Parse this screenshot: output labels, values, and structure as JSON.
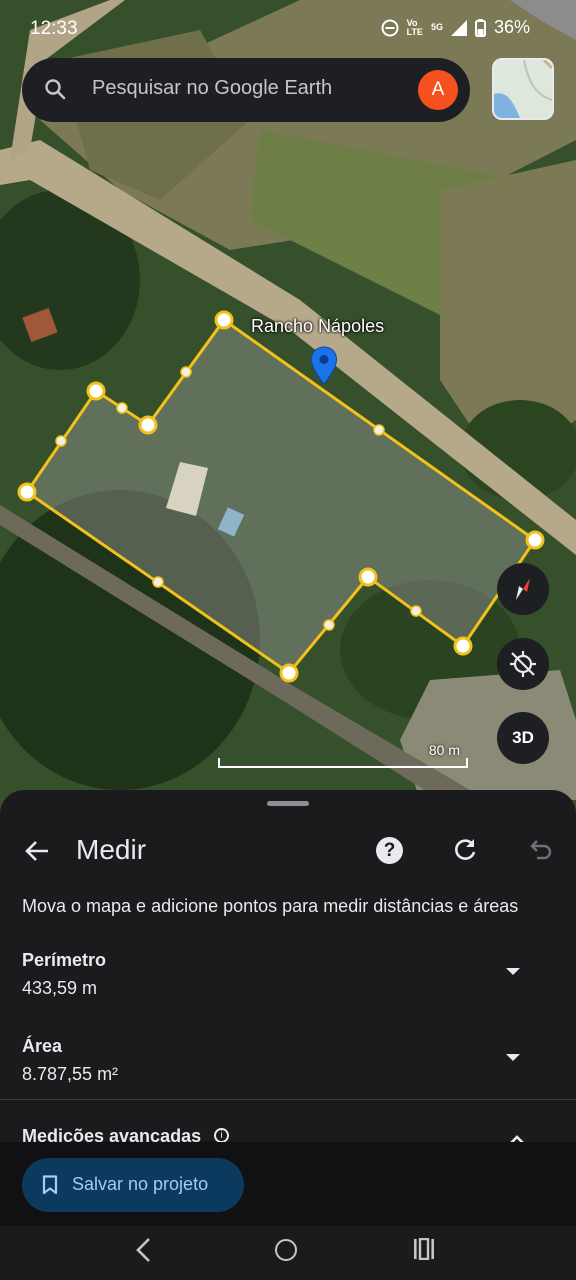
{
  "status": {
    "time": "12:33",
    "network_top": "Vo",
    "network_mid": "LTE",
    "network_type": "5G",
    "battery": "36%"
  },
  "search": {
    "placeholder": "Pesquisar no Google Earth",
    "avatar_letter": "A"
  },
  "map": {
    "place_label": "Rancho Nápoles",
    "scale_label": "80 m",
    "view_mode_label": "3D"
  },
  "sheet": {
    "title": "Medir",
    "help_label": "?",
    "instruction": "Mova o mapa e adicione pontos para medir distâncias e áreas",
    "perimeter_label": "Perímetro",
    "perimeter_value": "433,59 m",
    "area_label": "Área",
    "area_value": "8.787,55 m²",
    "advanced_label": "Medições avançadas",
    "advanced_info": "i"
  },
  "save": {
    "label": "Salvar no projeto"
  },
  "colors": {
    "polygon_stroke": "#f2c21b",
    "save_button_bg": "#0b3a5e",
    "save_button_text": "#a8c7fa",
    "avatar_bg": "#f4511e",
    "pin": "#1a73e8"
  },
  "icons": {
    "search": "search-icon",
    "back": "arrow-left-icon",
    "help": "help-circle-icon",
    "reset": "refresh-icon",
    "undo": "undo-icon",
    "compass": "compass-icon",
    "locate": "location-off-icon",
    "bookmark": "bookmark-icon",
    "nav_back": "nav-back-icon",
    "nav_home": "nav-home-icon",
    "nav_recent": "nav-recent-icon"
  }
}
